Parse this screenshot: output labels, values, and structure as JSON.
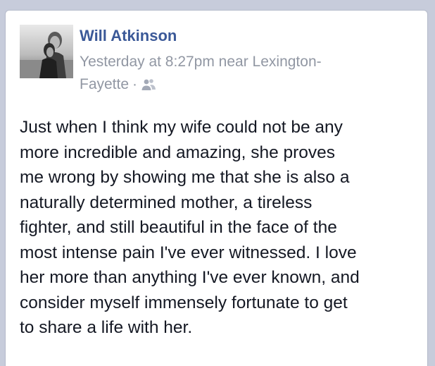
{
  "post": {
    "author_name": "Will Atkinson",
    "meta_line1": "Yesterday at 8:27pm near Lexington-",
    "meta_line2": "Fayette",
    "meta_separator": "·",
    "audience_icon": "friends-icon",
    "text_lines": [
      "Just when I think my wife could not be any",
      "more incredible and amazing, she proves",
      "me wrong by showing me that she is also a",
      "naturally determined mother, a tireless",
      "fighter, and still beautiful in the face of the",
      "most intense pain I've ever witnessed. I love",
      "her more than anything I've ever known, and",
      "consider myself immensely fortunate to get",
      "to share a life with her."
    ]
  },
  "colors": {
    "background": "#c7ccdb",
    "author_link": "#3b5998",
    "meta_text": "#9197a3",
    "body_text": "#141823"
  }
}
